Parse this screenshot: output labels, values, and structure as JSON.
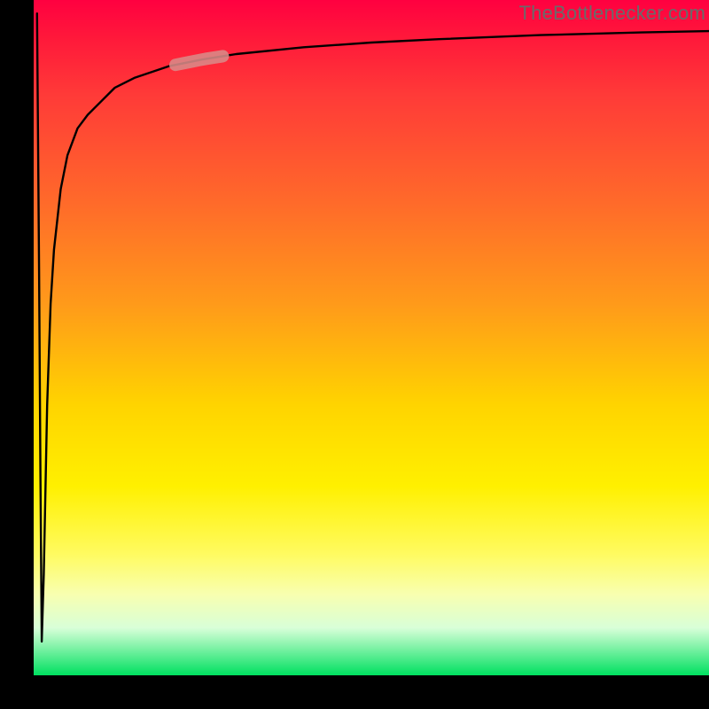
{
  "watermark": "TheBottlenecker.com",
  "colors": {
    "frame": "#000000",
    "curve": "#000000",
    "highlight": "#d98a87"
  },
  "chart_data": {
    "type": "line",
    "title": "",
    "xlabel": "",
    "ylabel": "",
    "xlim": [
      0,
      100
    ],
    "ylim": [
      0,
      100
    ],
    "grid": false,
    "legend": false,
    "series": [
      {
        "name": "curve",
        "x": [
          0.5,
          0.8,
          1.0,
          1.2,
          1.5,
          2.0,
          2.5,
          3.0,
          4.0,
          5.0,
          6.5,
          8.0,
          10,
          12,
          15,
          20,
          25,
          30,
          40,
          50,
          60,
          75,
          90,
          100
        ],
        "y": [
          98,
          60,
          30,
          5,
          15,
          40,
          55,
          63,
          72,
          77,
          81,
          83,
          85,
          87,
          88.5,
          90.2,
          91.2,
          92,
          93,
          93.7,
          94.2,
          94.8,
          95.2,
          95.4
        ]
      }
    ],
    "annotations": [
      {
        "name": "highlight-segment",
        "x_range": [
          21,
          28
        ],
        "note": "thick pink highlight along the curve"
      }
    ]
  }
}
